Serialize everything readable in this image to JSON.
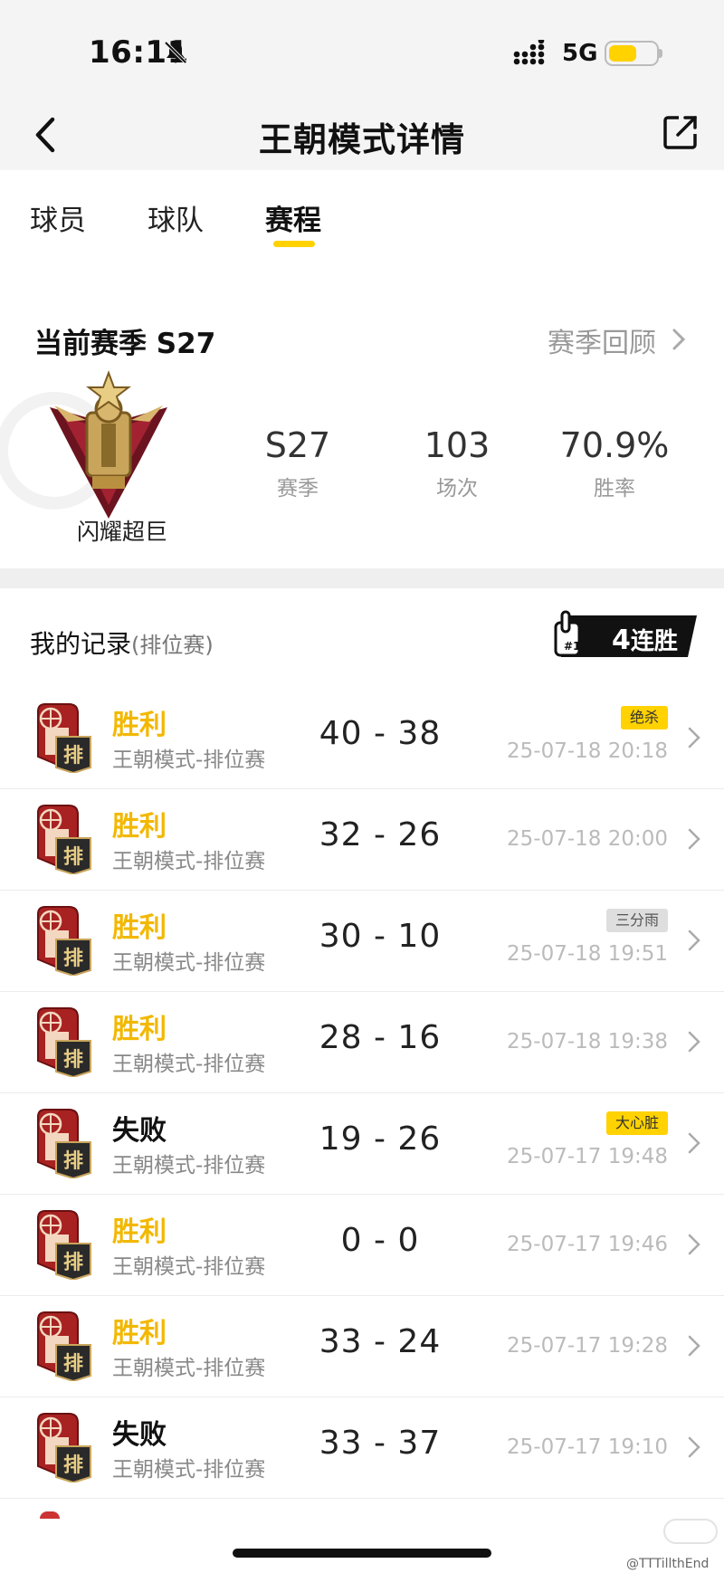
{
  "status_bar": {
    "time": "16:11",
    "network": "5G"
  },
  "nav": {
    "title": "王朝模式详情"
  },
  "tabs": [
    {
      "label": "球员"
    },
    {
      "label": "球队"
    },
    {
      "label": "赛程"
    }
  ],
  "season": {
    "title": "当前赛季 S27",
    "review_label": "赛季回顾",
    "badge_name": "闪耀超巨",
    "stats": [
      {
        "value": "S27",
        "label": "赛季"
      },
      {
        "value": "103",
        "label": "场次"
      },
      {
        "value": "70.9%",
        "label": "胜率"
      }
    ]
  },
  "records": {
    "title": "我的记录",
    "subtitle": "(排位赛)",
    "streak_num": "4",
    "streak_label": "连胜",
    "badge_char": "排",
    "items": [
      {
        "result": "胜利",
        "mode": "王朝模式-排位赛",
        "score": "40 - 38",
        "tag": "绝杀",
        "date": "25-07-18 20:18"
      },
      {
        "result": "胜利",
        "mode": "王朝模式-排位赛",
        "score": "32 - 26",
        "tag": "",
        "date": "25-07-18 20:00"
      },
      {
        "result": "胜利",
        "mode": "王朝模式-排位赛",
        "score": "30 - 10",
        "tag": "三分雨",
        "date": "25-07-18 19:51"
      },
      {
        "result": "胜利",
        "mode": "王朝模式-排位赛",
        "score": "28 - 16",
        "tag": "",
        "date": "25-07-18 19:38"
      },
      {
        "result": "失败",
        "mode": "王朝模式-排位赛",
        "score": "19 - 26",
        "tag": "大心脏",
        "date": "25-07-17 19:48"
      },
      {
        "result": "胜利",
        "mode": "王朝模式-排位赛",
        "score": "0 - 0",
        "tag": "",
        "date": "25-07-17 19:46"
      },
      {
        "result": "胜利",
        "mode": "王朝模式-排位赛",
        "score": "33 - 24",
        "tag": "",
        "date": "25-07-17 19:28"
      },
      {
        "result": "失败",
        "mode": "王朝模式-排位赛",
        "score": "33 - 37",
        "tag": "",
        "date": "25-07-17 19:10"
      }
    ]
  },
  "watermark": "@TTTillthEnd",
  "colors": {
    "accent": "#ffd200",
    "win": "#f2b800",
    "muted": "#999999",
    "badge_red": "#9e1b1b"
  }
}
